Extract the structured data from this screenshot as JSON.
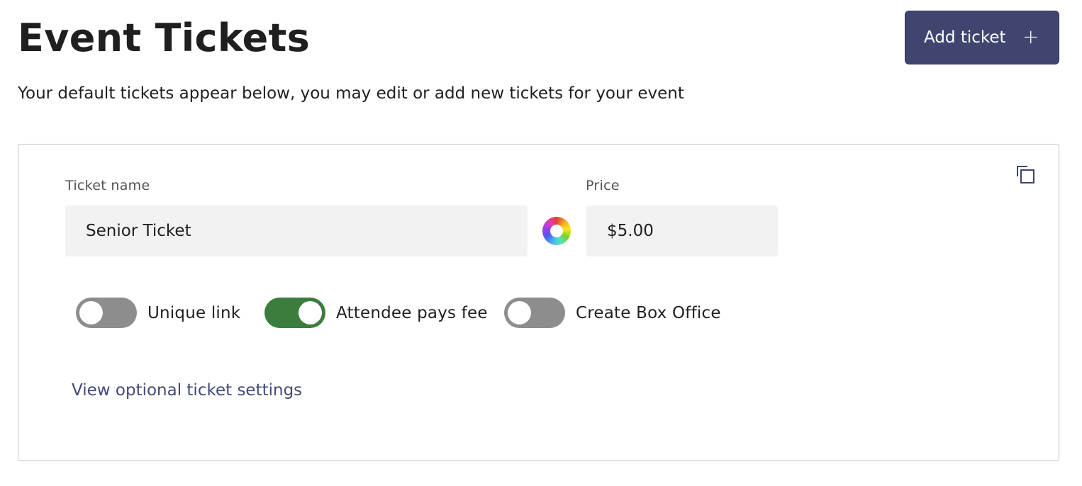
{
  "header": {
    "title": "Event Tickets",
    "subtitle": "Your default tickets appear below, you may edit or add new tickets for your event",
    "add_button_label": "Add ticket",
    "add_button_icon": "+"
  },
  "ticket": {
    "name_label": "Ticket name",
    "name_value": "Senior Ticket",
    "price_label": "Price",
    "price_value": "$5.00",
    "color_picker_icon": "color-wheel-icon",
    "copy_icon": "duplicate-icon",
    "toggles": [
      {
        "label": "Unique link",
        "on": false
      },
      {
        "label": "Attendee pays fee",
        "on": true
      },
      {
        "label": "Create Box Office",
        "on": false
      }
    ],
    "settings_link": "View optional ticket settings"
  },
  "colors": {
    "primary": "#3f456f",
    "toggle_on": "#3b7d3e",
    "toggle_off": "#8d8d8d",
    "link": "#444a78",
    "input_bg": "#f2f2f2"
  }
}
